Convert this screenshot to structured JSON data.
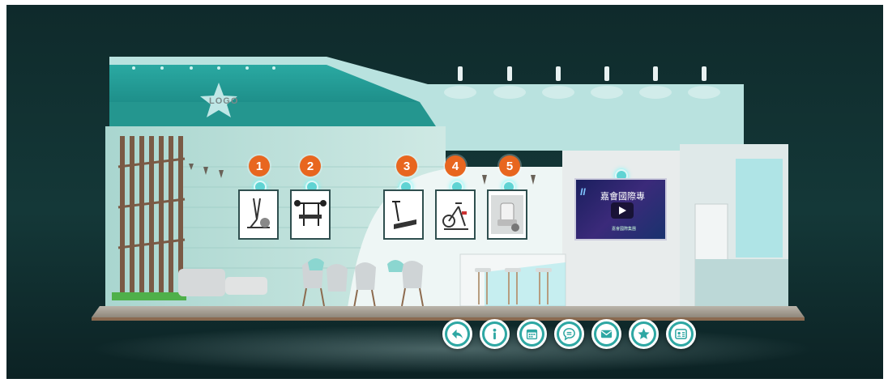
{
  "booth": {
    "logo_text": "LOGO",
    "markers": [
      {
        "label": "1",
        "product": "elliptical trainer"
      },
      {
        "label": "2",
        "product": "weight bench"
      },
      {
        "label": "3",
        "product": "treadmill"
      },
      {
        "label": "4",
        "product": "spin bike"
      },
      {
        "label": "5",
        "product": "massage chair"
      }
    ],
    "video": {
      "logo": "II",
      "title": "嘉會國際專",
      "subtitle": "嘉會國際集團",
      "play_icon": "play-icon"
    }
  },
  "toolbar": {
    "buttons": [
      {
        "name": "back",
        "icon": "back-arrow-icon"
      },
      {
        "name": "info",
        "icon": "info-icon"
      },
      {
        "name": "calendar",
        "icon": "calendar-icon"
      },
      {
        "name": "chat",
        "icon": "chat-icon"
      },
      {
        "name": "mail",
        "icon": "mail-icon"
      },
      {
        "name": "favorite",
        "icon": "star-icon"
      },
      {
        "name": "business-card",
        "icon": "contact-card-icon"
      }
    ]
  },
  "colors": {
    "accent_teal": "#2ea7a3",
    "marker_orange": "#e8661f",
    "hotspot": "#5fd3d3",
    "background": "#143838"
  }
}
